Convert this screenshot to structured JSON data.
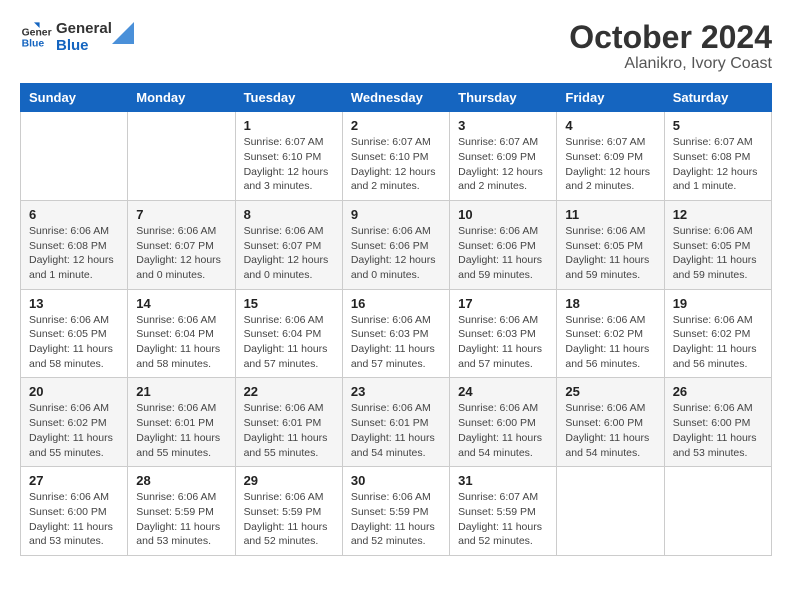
{
  "logo": {
    "text_general": "General",
    "text_blue": "Blue"
  },
  "title": "October 2024",
  "subtitle": "Alanikro, Ivory Coast",
  "days_of_week": [
    "Sunday",
    "Monday",
    "Tuesday",
    "Wednesday",
    "Thursday",
    "Friday",
    "Saturday"
  ],
  "weeks": [
    [
      {
        "day": "",
        "detail": ""
      },
      {
        "day": "",
        "detail": ""
      },
      {
        "day": "1",
        "detail": "Sunrise: 6:07 AM\nSunset: 6:10 PM\nDaylight: 12 hours and 3 minutes."
      },
      {
        "day": "2",
        "detail": "Sunrise: 6:07 AM\nSunset: 6:10 PM\nDaylight: 12 hours and 2 minutes."
      },
      {
        "day": "3",
        "detail": "Sunrise: 6:07 AM\nSunset: 6:09 PM\nDaylight: 12 hours and 2 minutes."
      },
      {
        "day": "4",
        "detail": "Sunrise: 6:07 AM\nSunset: 6:09 PM\nDaylight: 12 hours and 2 minutes."
      },
      {
        "day": "5",
        "detail": "Sunrise: 6:07 AM\nSunset: 6:08 PM\nDaylight: 12 hours and 1 minute."
      }
    ],
    [
      {
        "day": "6",
        "detail": "Sunrise: 6:06 AM\nSunset: 6:08 PM\nDaylight: 12 hours and 1 minute."
      },
      {
        "day": "7",
        "detail": "Sunrise: 6:06 AM\nSunset: 6:07 PM\nDaylight: 12 hours and 0 minutes."
      },
      {
        "day": "8",
        "detail": "Sunrise: 6:06 AM\nSunset: 6:07 PM\nDaylight: 12 hours and 0 minutes."
      },
      {
        "day": "9",
        "detail": "Sunrise: 6:06 AM\nSunset: 6:06 PM\nDaylight: 12 hours and 0 minutes."
      },
      {
        "day": "10",
        "detail": "Sunrise: 6:06 AM\nSunset: 6:06 PM\nDaylight: 11 hours and 59 minutes."
      },
      {
        "day": "11",
        "detail": "Sunrise: 6:06 AM\nSunset: 6:05 PM\nDaylight: 11 hours and 59 minutes."
      },
      {
        "day": "12",
        "detail": "Sunrise: 6:06 AM\nSunset: 6:05 PM\nDaylight: 11 hours and 59 minutes."
      }
    ],
    [
      {
        "day": "13",
        "detail": "Sunrise: 6:06 AM\nSunset: 6:05 PM\nDaylight: 11 hours and 58 minutes."
      },
      {
        "day": "14",
        "detail": "Sunrise: 6:06 AM\nSunset: 6:04 PM\nDaylight: 11 hours and 58 minutes."
      },
      {
        "day": "15",
        "detail": "Sunrise: 6:06 AM\nSunset: 6:04 PM\nDaylight: 11 hours and 57 minutes."
      },
      {
        "day": "16",
        "detail": "Sunrise: 6:06 AM\nSunset: 6:03 PM\nDaylight: 11 hours and 57 minutes."
      },
      {
        "day": "17",
        "detail": "Sunrise: 6:06 AM\nSunset: 6:03 PM\nDaylight: 11 hours and 57 minutes."
      },
      {
        "day": "18",
        "detail": "Sunrise: 6:06 AM\nSunset: 6:02 PM\nDaylight: 11 hours and 56 minutes."
      },
      {
        "day": "19",
        "detail": "Sunrise: 6:06 AM\nSunset: 6:02 PM\nDaylight: 11 hours and 56 minutes."
      }
    ],
    [
      {
        "day": "20",
        "detail": "Sunrise: 6:06 AM\nSunset: 6:02 PM\nDaylight: 11 hours and 55 minutes."
      },
      {
        "day": "21",
        "detail": "Sunrise: 6:06 AM\nSunset: 6:01 PM\nDaylight: 11 hours and 55 minutes."
      },
      {
        "day": "22",
        "detail": "Sunrise: 6:06 AM\nSunset: 6:01 PM\nDaylight: 11 hours and 55 minutes."
      },
      {
        "day": "23",
        "detail": "Sunrise: 6:06 AM\nSunset: 6:01 PM\nDaylight: 11 hours and 54 minutes."
      },
      {
        "day": "24",
        "detail": "Sunrise: 6:06 AM\nSunset: 6:00 PM\nDaylight: 11 hours and 54 minutes."
      },
      {
        "day": "25",
        "detail": "Sunrise: 6:06 AM\nSunset: 6:00 PM\nDaylight: 11 hours and 54 minutes."
      },
      {
        "day": "26",
        "detail": "Sunrise: 6:06 AM\nSunset: 6:00 PM\nDaylight: 11 hours and 53 minutes."
      }
    ],
    [
      {
        "day": "27",
        "detail": "Sunrise: 6:06 AM\nSunset: 6:00 PM\nDaylight: 11 hours and 53 minutes."
      },
      {
        "day": "28",
        "detail": "Sunrise: 6:06 AM\nSunset: 5:59 PM\nDaylight: 11 hours and 53 minutes."
      },
      {
        "day": "29",
        "detail": "Sunrise: 6:06 AM\nSunset: 5:59 PM\nDaylight: 11 hours and 52 minutes."
      },
      {
        "day": "30",
        "detail": "Sunrise: 6:06 AM\nSunset: 5:59 PM\nDaylight: 11 hours and 52 minutes."
      },
      {
        "day": "31",
        "detail": "Sunrise: 6:07 AM\nSunset: 5:59 PM\nDaylight: 11 hours and 52 minutes."
      },
      {
        "day": "",
        "detail": ""
      },
      {
        "day": "",
        "detail": ""
      }
    ]
  ]
}
